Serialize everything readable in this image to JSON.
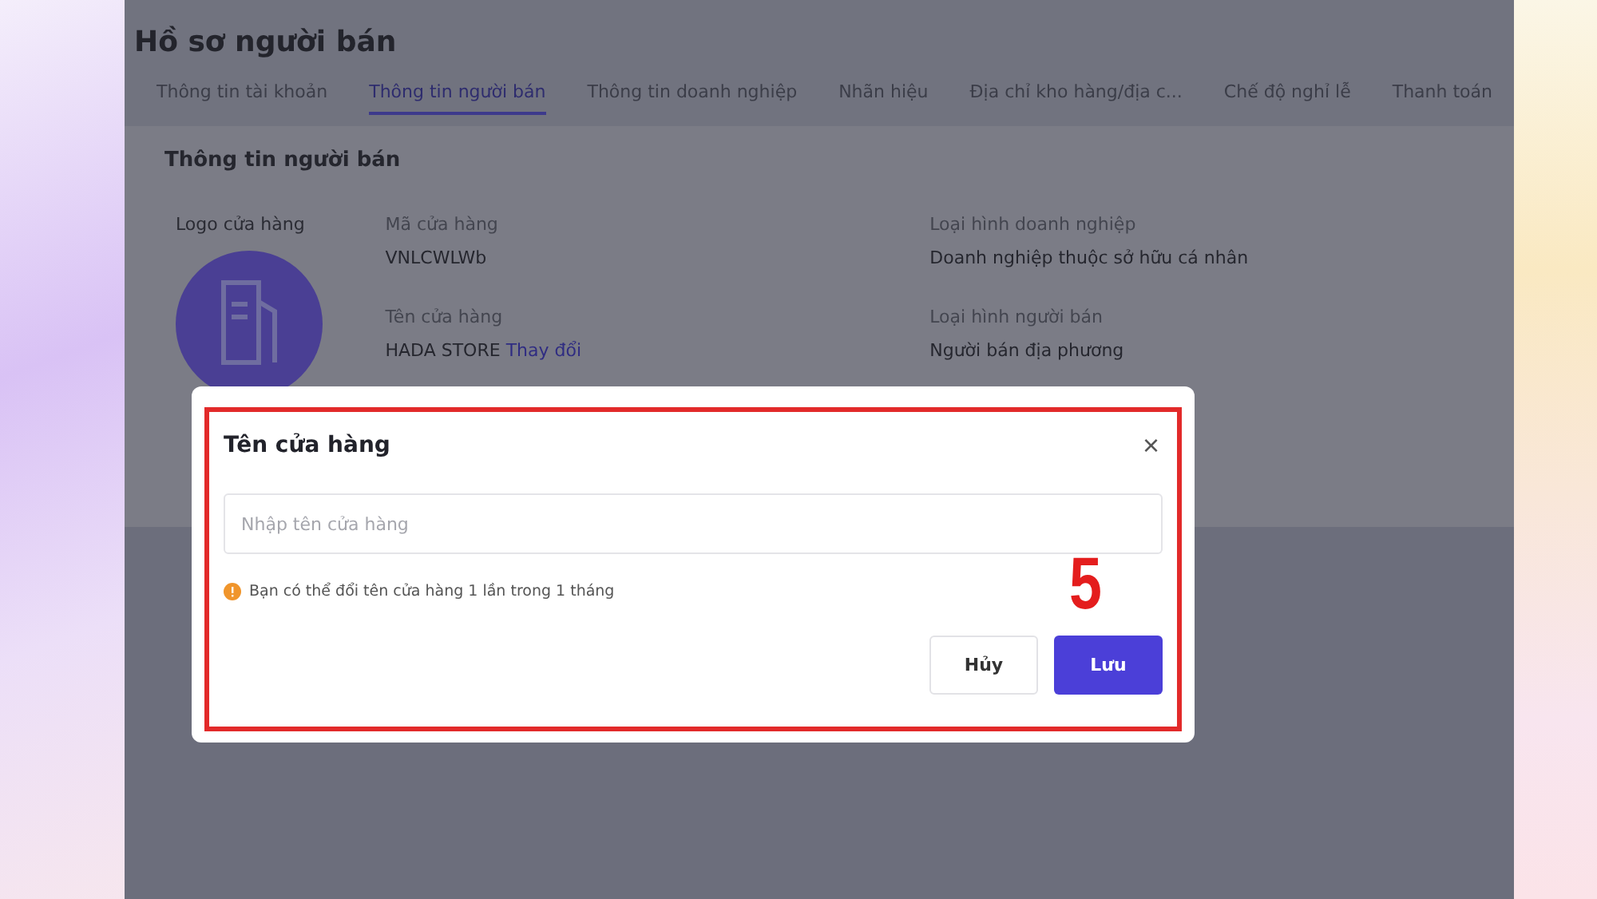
{
  "page": {
    "title": "Hồ sơ người bán"
  },
  "tabs": [
    {
      "label": "Thông tin tài khoản",
      "selected": false
    },
    {
      "label": "Thông tin người bán",
      "selected": true
    },
    {
      "label": "Thông tin doanh nghiệp",
      "selected": false
    },
    {
      "label": "Nhãn hiệu",
      "selected": false
    },
    {
      "label": "Địa chỉ kho hàng/địa c...",
      "selected": false
    },
    {
      "label": "Chế độ nghỉ lễ",
      "selected": false
    },
    {
      "label": "Thanh toán",
      "selected": false
    }
  ],
  "section": {
    "title": "Thông tin người bán",
    "logo_label": "Logo cửa hàng",
    "fields": [
      {
        "label": "Mã cửa hàng",
        "value": "VNLCWLWb"
      },
      {
        "label": "Loại hình doanh nghiệp",
        "value": "Doanh nghiệp thuộc sở hữu cá nhân"
      },
      {
        "label": "Tên cửa hàng",
        "value": "HADA STORE",
        "link": "Thay đổi"
      },
      {
        "label": "Loại hình người bán",
        "value": "Người bán địa phương"
      }
    ]
  },
  "dialog": {
    "title": "Tên cửa hàng",
    "close": "×",
    "placeholder": "Nhập tên cửa hàng",
    "note": "Bạn có thể đổi tên cửa hàng 1 lần trong 1 tháng",
    "buttons": [
      {
        "label": "Hủy",
        "kind": "secondary"
      },
      {
        "label": "Lưu",
        "kind": "primary"
      }
    ],
    "step": "5"
  }
}
